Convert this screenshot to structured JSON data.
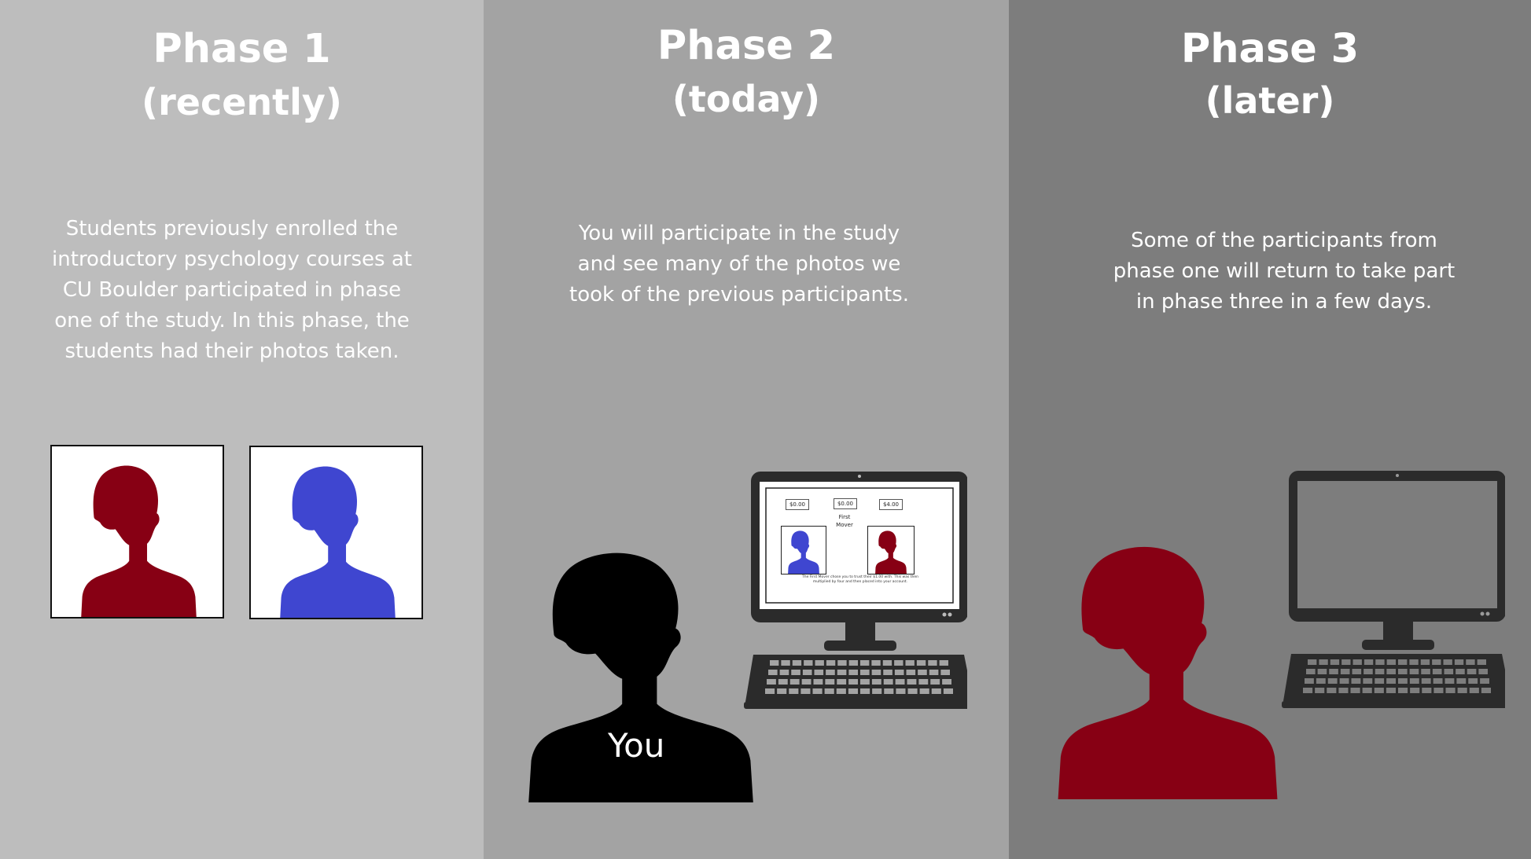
{
  "colors": {
    "phase1_bg": "#bdbdbd",
    "phase2_bg": "#a3a3a3",
    "phase3_bg": "#7d7d7d",
    "red_silhouette": "#870014",
    "blue_silhouette": "#3f46d0",
    "black_silhouette": "#000000"
  },
  "phases": [
    {
      "title": "Phase 1",
      "subtitle": "(recently)",
      "description": "Students previously enrolled the introductory psychology courses at CU Boulder participated in phase one of the study. In this phase, the students had their photos taken."
    },
    {
      "title": "Phase 2",
      "subtitle": "(today)",
      "description": "You will participate in the study and see many of the photos we took of the previous participants.",
      "person_label": "You",
      "screen": {
        "amount_left": "$0.00",
        "amount_mid": "$0.00",
        "amount_right": "$4.00",
        "first_mover_line1": "First",
        "first_mover_line2": "Mover",
        "caption_line1": "The First Mover chose you to trust their $1.00 with. This was then",
        "caption_line2": "multiplied by four and then placed into your account."
      }
    },
    {
      "title": "Phase 3",
      "subtitle": "(later)",
      "description": "Some of the participants from phase one will return to take part in phase three in a few days."
    }
  ]
}
